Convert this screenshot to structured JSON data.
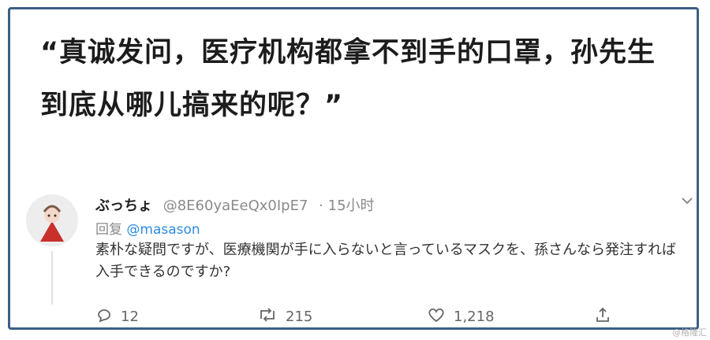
{
  "headline": "“真诚发问，医疗机构都拿不到手的口罩，孙先生到底从哪儿搞来的呢？”",
  "tweet": {
    "display_name": "ぶっちょ",
    "handle": "@8E60yaEeQx0IpE7",
    "time": "· 15小时",
    "reply_prefix": "回复",
    "reply_to": "@masason",
    "text": "素朴な疑問ですが、医療機関が手に入らないと言っているマスクを、孫さんなら発注すれば入手できるのですか?",
    "counts": {
      "replies": "12",
      "retweets": "215",
      "likes": "1,218"
    }
  },
  "icons": {
    "more": "chevron-down-icon",
    "reply": "comment-icon",
    "retweet": "retweet-icon",
    "like": "heart-icon",
    "share": "share-icon"
  },
  "watermark": "@格隆汇",
  "colors": {
    "frame": "#3a5f86",
    "mention": "#2b8be0",
    "meta": "#8a8a8a"
  }
}
